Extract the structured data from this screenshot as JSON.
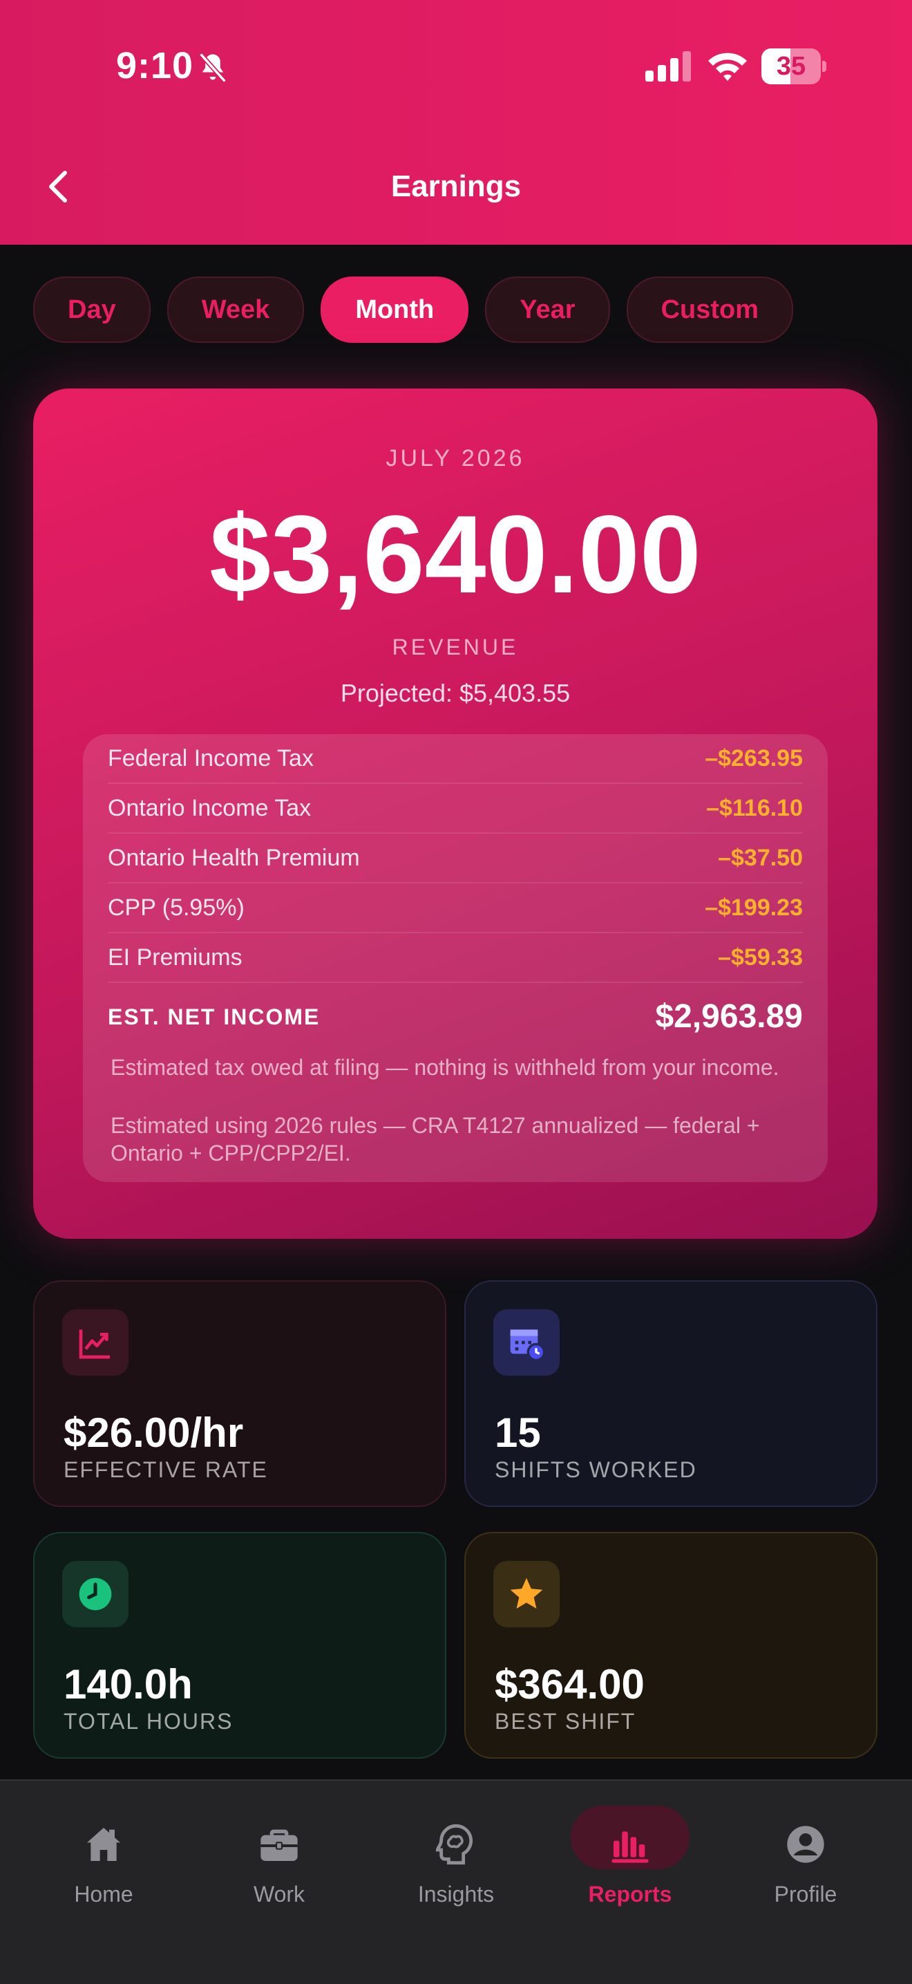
{
  "status_bar": {
    "time": "9:10",
    "battery": "35"
  },
  "header": {
    "title": "Earnings"
  },
  "tabs": [
    {
      "label": "Day",
      "active": false
    },
    {
      "label": "Week",
      "active": false
    },
    {
      "label": "Month",
      "active": true
    },
    {
      "label": "Year",
      "active": false
    },
    {
      "label": "Custom",
      "active": false
    }
  ],
  "summary": {
    "period": "JULY 2026",
    "amount": "$3,640.00",
    "amount_label": "REVENUE",
    "projected": "Projected: $5,403.55",
    "deductions": [
      {
        "label": "Federal Income Tax",
        "value": "–$263.95"
      },
      {
        "label": "Ontario Income Tax",
        "value": "–$116.10"
      },
      {
        "label": "Ontario Health Premium",
        "value": "–$37.50"
      },
      {
        "label": "CPP (5.95%)",
        "value": "–$199.23"
      },
      {
        "label": "EI Premiums",
        "value": "–$59.33"
      }
    ],
    "net_label": "EST. NET INCOME",
    "net_value": "$2,963.89",
    "note1": "Estimated tax owed at filing — nothing is withheld from your income.",
    "note2": "Estimated using 2026 rules — CRA T4127 annualized — federal + Ontario + CPP/CPP2/EI."
  },
  "stats": [
    {
      "icon": "trending-up-icon",
      "value": "$26.00/hr",
      "label": "EFFECTIVE RATE",
      "color": "#e91e63"
    },
    {
      "icon": "calendar-clock-icon",
      "value": "15",
      "label": "SHIFTS WORKED",
      "color": "#6b6cf6"
    },
    {
      "icon": "clock-icon",
      "value": "140.0h",
      "label": "TOTAL HOURS",
      "color": "#19c37d"
    },
    {
      "icon": "star-icon",
      "value": "$364.00",
      "label": "BEST SHIFT",
      "color": "#ffa726"
    }
  ],
  "nav": [
    {
      "label": "Home",
      "icon": "home-icon"
    },
    {
      "label": "Work",
      "icon": "briefcase-icon"
    },
    {
      "label": "Insights",
      "icon": "brain-icon"
    },
    {
      "label": "Reports",
      "icon": "bar-chart-icon",
      "active": true
    },
    {
      "label": "Profile",
      "icon": "person-icon"
    }
  ],
  "colors": {
    "accent": "#e91e63",
    "deduction": "#ffb22b",
    "background": "#0e0e11"
  }
}
